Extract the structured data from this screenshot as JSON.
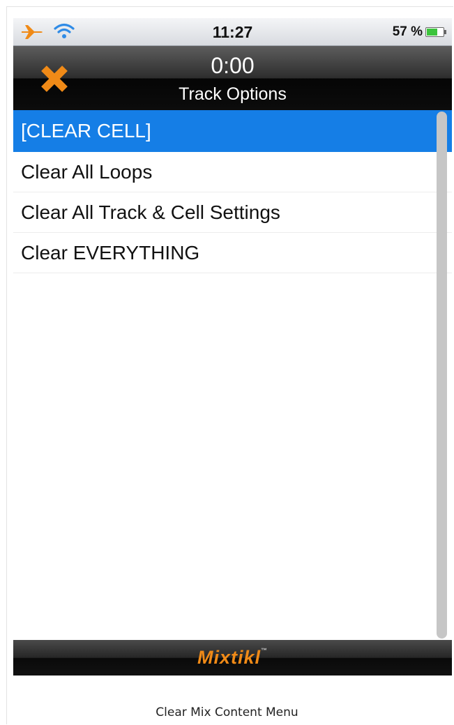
{
  "status_bar": {
    "time": "11:27",
    "battery_percent": "57 %",
    "icons": [
      "airplane-icon",
      "wifi-icon",
      "battery-icon"
    ],
    "accent_color": "#f08a17"
  },
  "nav": {
    "time": "0:00",
    "title": "Track Options",
    "close_icon": "close-icon"
  },
  "options": [
    {
      "label": "[CLEAR CELL]",
      "selected": true
    },
    {
      "label": "Clear All Loops",
      "selected": false
    },
    {
      "label": "Clear All Track & Cell Settings",
      "selected": false
    },
    {
      "label": "Clear EVERYTHING",
      "selected": false
    }
  ],
  "footer": {
    "brand": "Mixtikl",
    "trademark": "™"
  },
  "caption": "Clear Mix Content Menu",
  "colors": {
    "selection": "#157ee6",
    "brand": "#f08a17"
  }
}
